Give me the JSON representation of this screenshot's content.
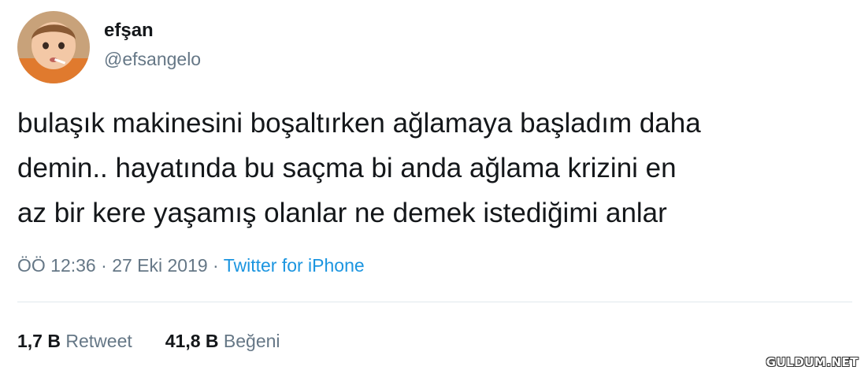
{
  "user": {
    "display_name": "efşan",
    "handle": "@efsangelo"
  },
  "tweet": {
    "lines": [
      "bulaşık makinesini boşaltırken ağlamaya başladım daha",
      "demin.. hayatında bu saçma bi anda ağlama krizini en",
      "az bir kere yaşamış olanlar ne demek istediğimi anlar"
    ],
    "time": "ÖÖ 12:36",
    "separator": " · ",
    "date": "27 Eki 2019",
    "source": "Twitter for iPhone"
  },
  "stats": {
    "retweets_count": "1,7 B",
    "retweets_label": "Retweet",
    "likes_count": "41,8 B",
    "likes_label": "Beğeni"
  },
  "watermark": "GULDUM.NET",
  "colors": {
    "text": "#14171a",
    "secondary": "#657786",
    "link": "#1b95e0",
    "divider": "#e1e8ed"
  }
}
